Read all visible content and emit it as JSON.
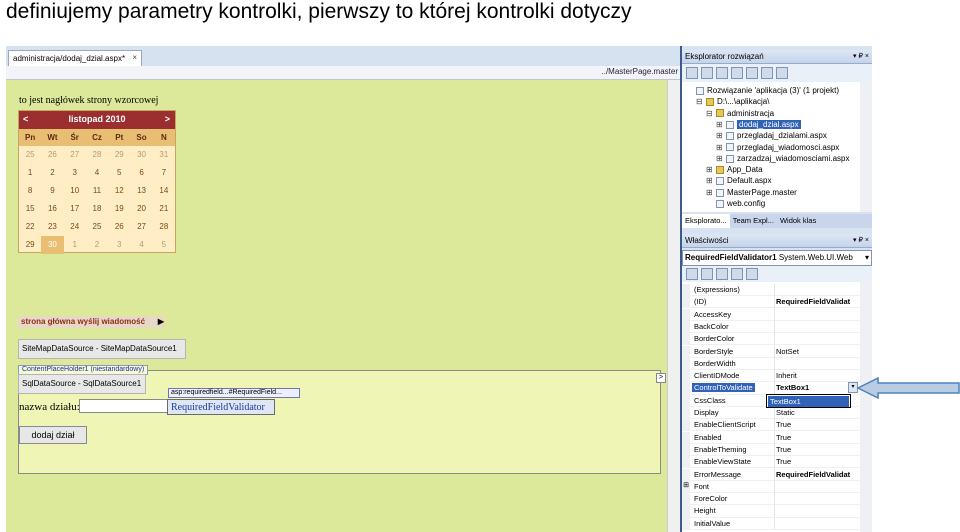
{
  "slide": {
    "title": "definiujemy parametry kontrolki, pierwszy to której kontrolki dotyczy"
  },
  "designer": {
    "doc_tab": "administracja/dodaj_dzial.aspx*",
    "doc_tab_close": "×",
    "breadcrumb": "../MasterPage.master",
    "header_text": "to jest nagłówek strony wzorcowej",
    "calendar": {
      "prev": "<",
      "next": ">",
      "month": "listopad 2010",
      "days_of_week": [
        "Pn",
        "Wt",
        "Śr",
        "Cz",
        "Pt",
        "So",
        "N"
      ],
      "weeks": [
        [
          "25",
          "26",
          "27",
          "28",
          "29",
          "30",
          "31"
        ],
        [
          "1",
          "2",
          "3",
          "4",
          "5",
          "6",
          "7"
        ],
        [
          "8",
          "9",
          "10",
          "11",
          "12",
          "13",
          "14"
        ],
        [
          "15",
          "16",
          "17",
          "18",
          "19",
          "20",
          "21"
        ],
        [
          "22",
          "23",
          "24",
          "25",
          "26",
          "27",
          "28"
        ],
        [
          "29",
          "30",
          "1",
          "2",
          "3",
          "4",
          "5"
        ]
      ]
    },
    "menu": "strona główna  wyślij wiadomość",
    "menu_arrow": "▶",
    "sitemap_ds": "SiteMapDataSource - SiteMapDataSource1",
    "cph_tab": "ContentPlaceHolder1 (niestandardowy)",
    "cph_chevron": ">",
    "sql_ds": "SqlDataSource - SqlDataSource1",
    "name_label": "nazwa działu:",
    "validator_tag": "asp:requiredfield...#RequiredField...",
    "validator": "RequiredFieldValidator",
    "add_button": "dodaj dział"
  },
  "solution_explorer": {
    "title": "Eksplorator rozwiązań",
    "title_controls": "▾ ₽ ×",
    "tree": [
      {
        "label": "Rozwiązanie 'aplikacja (3)' (1 projekt)",
        "indent": 0,
        "expander": "",
        "folder": false,
        "selected": false
      },
      {
        "label": "D:\\...\\aplikacja\\",
        "indent": 1,
        "expander": "⊟",
        "folder": true,
        "selected": false
      },
      {
        "label": "administracja",
        "indent": 2,
        "expander": "⊟",
        "folder": true,
        "selected": false
      },
      {
        "label": "dodaj_dzial.aspx",
        "indent": 3,
        "expander": "⊞",
        "folder": false,
        "selected": true
      },
      {
        "label": "przegladaj_dzialami.aspx",
        "indent": 3,
        "expander": "⊞",
        "folder": false,
        "selected": false
      },
      {
        "label": "przegladaj_wiadomosci.aspx",
        "indent": 3,
        "expander": "⊞",
        "folder": false,
        "selected": false
      },
      {
        "label": "zarzadzaj_wiadomosciami.aspx",
        "indent": 3,
        "expander": "⊞",
        "folder": false,
        "selected": false
      },
      {
        "label": "App_Data",
        "indent": 2,
        "expander": "⊞",
        "folder": true,
        "selected": false
      },
      {
        "label": "Default.aspx",
        "indent": 2,
        "expander": "⊞",
        "folder": false,
        "selected": false
      },
      {
        "label": "MasterPage.master",
        "indent": 2,
        "expander": "⊞",
        "folder": false,
        "selected": false
      },
      {
        "label": "web.config",
        "indent": 2,
        "expander": "",
        "folder": false,
        "selected": false
      }
    ],
    "tabs": [
      "Eksplorato...",
      "Team Expl...",
      "Widok klas"
    ]
  },
  "properties": {
    "title": "Właściwości",
    "title_controls": "▾ ₽ ×",
    "object": "RequiredFieldValidator1",
    "object_type": "System.Web.UI.Web",
    "object_dropdown": "▾",
    "rows": [
      {
        "key": "(Expressions)",
        "value": "",
        "bold": false,
        "gutter": ""
      },
      {
        "key": "(ID)",
        "value": "RequiredFieldValidat",
        "bold": true,
        "gutter": ""
      },
      {
        "key": "AccessKey",
        "value": "",
        "bold": false,
        "gutter": ""
      },
      {
        "key": "BackColor",
        "value": "",
        "bold": false,
        "gutter": ""
      },
      {
        "key": "BorderColor",
        "value": "",
        "bold": false,
        "gutter": ""
      },
      {
        "key": "BorderStyle",
        "value": "NotSet",
        "bold": false,
        "gutter": ""
      },
      {
        "key": "BorderWidth",
        "value": "",
        "bold": false,
        "gutter": ""
      },
      {
        "key": "ClientIDMode",
        "value": "Inherit",
        "bold": false,
        "gutter": ""
      },
      {
        "key": "ControlToValidate",
        "value": "TextBox1",
        "bold": true,
        "gutter": "",
        "selected": true
      },
      {
        "key": "CssClass",
        "value": "",
        "bold": false,
        "gutter": ""
      },
      {
        "key": "Display",
        "value": "Static",
        "bold": false,
        "gutter": ""
      },
      {
        "key": "EnableClientScript",
        "value": "True",
        "bold": false,
        "gutter": ""
      },
      {
        "key": "Enabled",
        "value": "True",
        "bold": false,
        "gutter": ""
      },
      {
        "key": "EnableTheming",
        "value": "True",
        "bold": false,
        "gutter": ""
      },
      {
        "key": "EnableViewState",
        "value": "True",
        "bold": false,
        "gutter": ""
      },
      {
        "key": "ErrorMessage",
        "value": "RequiredFieldValidat",
        "bold": true,
        "gutter": ""
      },
      {
        "key": "Font",
        "value": "",
        "bold": false,
        "gutter": "⊞"
      },
      {
        "key": "ForeColor",
        "value": "",
        "bold": false,
        "gutter": ""
      },
      {
        "key": "Height",
        "value": "",
        "bold": false,
        "gutter": ""
      },
      {
        "key": "InitialValue",
        "value": "",
        "bold": false,
        "gutter": ""
      }
    ],
    "dropdown_button": "▾",
    "dropdown_option": "TextBox1"
  },
  "colors": {
    "arrow_fill": "#b8cce4",
    "arrow_stroke": "#4f81bd",
    "selection": "#3062b8"
  }
}
